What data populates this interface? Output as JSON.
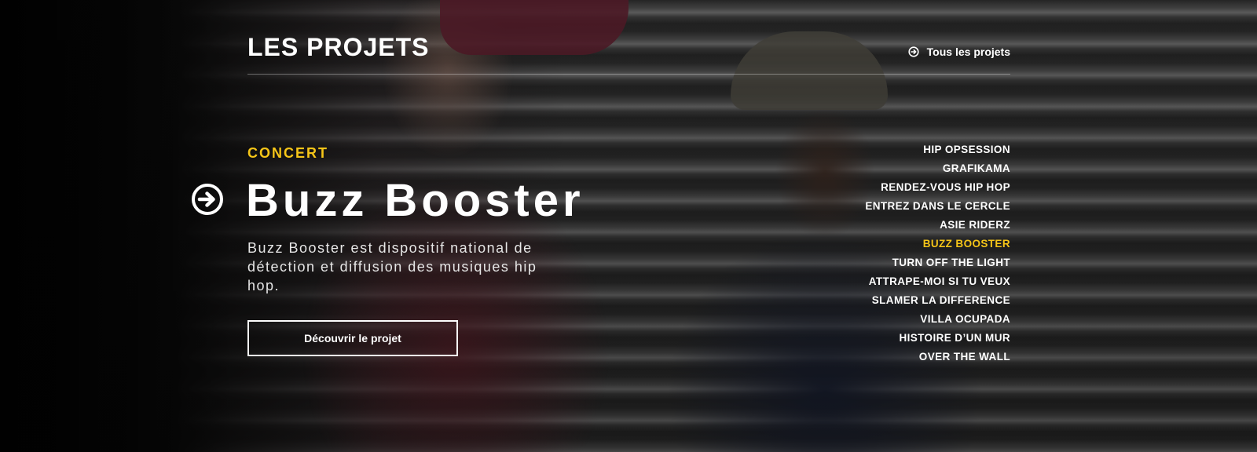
{
  "section_title": "LES PROJETS",
  "all_projects_link": {
    "label": "Tous les projets",
    "icon": "arrow-circle-right-icon"
  },
  "featured": {
    "category": "CONCERT",
    "title": "Buzz Booster",
    "description": "Buzz Booster est dispositif national de détection et diffusion des musiques hip hop.",
    "cta_label": "Découvrir le projet",
    "nav_icon": "arrow-circle-right-icon"
  },
  "project_list": {
    "items": [
      {
        "label": "HIP OPSESSION",
        "active": false
      },
      {
        "label": "GRAFIKAMA",
        "active": false
      },
      {
        "label": "RENDEZ-VOUS HIP HOP",
        "active": false
      },
      {
        "label": "ENTREZ DANS LE CERCLE",
        "active": false
      },
      {
        "label": "ASIE RIDERZ",
        "active": false
      },
      {
        "label": "BUZZ BOOSTER",
        "active": true
      },
      {
        "label": "TURN OFF THE LIGHT",
        "active": false
      },
      {
        "label": "ATTRAPE-MOI SI TU VEUX",
        "active": false
      },
      {
        "label": "SLAMER LA DIFFERENCE",
        "active": false
      },
      {
        "label": "VILLA OCUPADA",
        "active": false
      },
      {
        "label": "HISTOIRE D’UN MUR",
        "active": false
      },
      {
        "label": "OVER THE WALL",
        "active": false
      }
    ]
  },
  "colors": {
    "accent": "#f5c518",
    "text": "#ffffff",
    "background": "#0b0b0b"
  }
}
